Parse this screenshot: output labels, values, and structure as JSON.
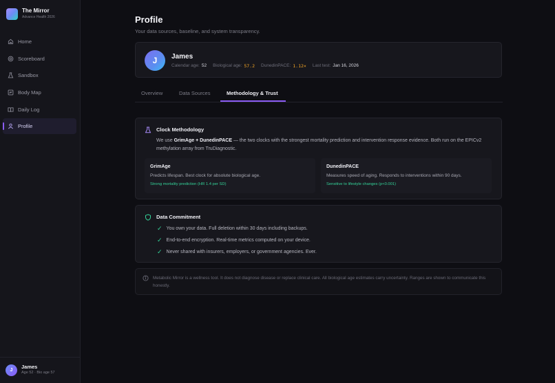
{
  "brand": {
    "title": "The Mirror",
    "subtitle": "Advance Health 2026"
  },
  "nav": [
    {
      "label": "Home",
      "icon": "home-icon",
      "active": false
    },
    {
      "label": "Scoreboard",
      "icon": "target-icon",
      "active": false
    },
    {
      "label": "Sandbox",
      "icon": "flask-icon",
      "active": false
    },
    {
      "label": "Body Map",
      "icon": "body-map-icon",
      "active": false
    },
    {
      "label": "Daily Log",
      "icon": "book-icon",
      "active": false
    },
    {
      "label": "Profile",
      "icon": "user-icon",
      "active": true
    }
  ],
  "user": {
    "initial": "J",
    "name": "James",
    "meta": "Age 52 · Bio age 57"
  },
  "page": {
    "title": "Profile",
    "subtitle": "Your data sources, baseline, and system transparency."
  },
  "profile": {
    "initial": "J",
    "name": "James",
    "calendar_age_label": "Calendar age:",
    "calendar_age": "52",
    "bio_age_label": "Biological age:",
    "bio_age": "57.2",
    "pace_label": "DunedinPACE:",
    "pace": "1.12×",
    "last_test_label": "Last test:",
    "last_test": "Jan 16, 2026"
  },
  "tabs": [
    {
      "label": "Overview",
      "active": false
    },
    {
      "label": "Data Sources",
      "active": false
    },
    {
      "label": "Methodology & Trust",
      "active": true
    }
  ],
  "methodology": {
    "title": "Clock Methodology",
    "desc_pre": "We use ",
    "desc_bold": "GrimAge + DunedinPACE",
    "desc_post": " — the two clocks with the strongest mortality prediction and intervention response evidence. Both run on the EPICv2 methylation array from TruDiagnostic.",
    "clocks": [
      {
        "name": "GrimAge",
        "desc": "Predicts lifespan. Best clock for absolute biological age.",
        "stat": "Strong mortality prediction (HR 1.4 per SD)"
      },
      {
        "name": "DunedinPACE",
        "desc": "Measures speed of aging. Responds to interventions within 90 days.",
        "stat": "Sensitive to lifestyle changes (p<0.001)"
      }
    ]
  },
  "commitment": {
    "title": "Data Commitment",
    "items": [
      "You own your data. Full deletion within 30 days including backups.",
      "End-to-end encryption. Real-time metrics computed on your device.",
      "Never shared with insurers, employers, or government agencies. Ever."
    ]
  },
  "disclaimer": "Metabolic Mirror is a wellness tool. It does not diagnose disease or replace clinical care. All biological age estimates carry uncertainty. Ranges are shown to communicate this honestly.",
  "colors": {
    "accent": "#8b5cf6",
    "success": "#34d399",
    "warning": "#f5a524"
  }
}
